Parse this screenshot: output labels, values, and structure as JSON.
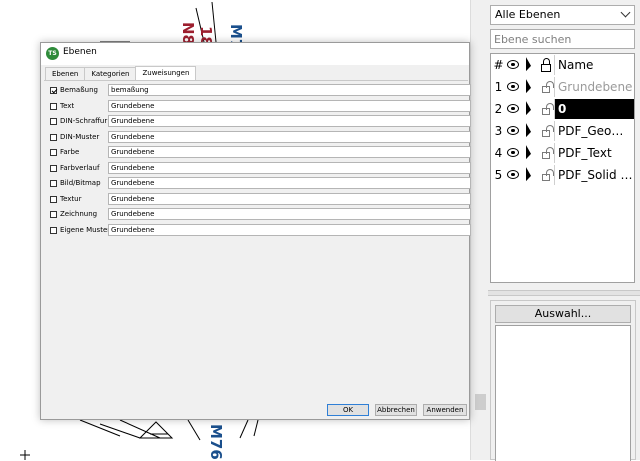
{
  "cad": {
    "labels": [
      "N8",
      "18",
      "M7",
      "M76"
    ]
  },
  "layer_panel": {
    "filter_value": "Alle Ebenen",
    "search_placeholder": "Ebene suchen",
    "columns": {
      "num": "#",
      "name": "Name"
    },
    "rows": [
      {
        "num": "1",
        "name": "Grundebene",
        "style": "gray",
        "locked": false
      },
      {
        "num": "2",
        "name": "0",
        "style": "selected",
        "locked": false
      },
      {
        "num": "3",
        "name": "PDF_Geome...",
        "style": "normal",
        "locked": false
      },
      {
        "num": "4",
        "name": "PDF_Text",
        "style": "normal",
        "locked": false
      },
      {
        "num": "5",
        "name": "PDF_Solid Fills",
        "style": "normal",
        "locked": false
      }
    ],
    "auswahl_label": "Auswahl..."
  },
  "dialog": {
    "app_icon_text": "TS",
    "title": "Ebenen",
    "tabs": [
      {
        "label": "Ebenen",
        "active": false
      },
      {
        "label": "Kategorien",
        "active": false
      },
      {
        "label": "Zuweisungen",
        "active": true
      }
    ],
    "assignments": [
      {
        "label": "Bemaßung",
        "value": "bemaßung",
        "checked": true
      },
      {
        "label": "Text",
        "value": "Grundebene",
        "checked": false
      },
      {
        "label": "DIN-Schraffur",
        "value": "Grundebene",
        "checked": false
      },
      {
        "label": "DIN-Muster",
        "value": "Grundebene",
        "checked": false
      },
      {
        "label": "Farbe",
        "value": "Grundebene",
        "checked": false
      },
      {
        "label": "Farbverlauf",
        "value": "Grundebene",
        "checked": false
      },
      {
        "label": "Bild/Bitmap",
        "value": "Grundebene",
        "checked": false
      },
      {
        "label": "Textur",
        "value": "Grundebene",
        "checked": false
      },
      {
        "label": "Zeichnung",
        "value": "Grundebene",
        "checked": false
      },
      {
        "label": "Eigene Muster",
        "value": "Grundebene",
        "checked": false
      }
    ],
    "ok_label": "OK",
    "cancel_label": "Abbrechen",
    "apply_label": "Anwenden"
  },
  "colors": {
    "label_red": "#9c1e2e",
    "label_blue": "#1a4f8c",
    "app_icon": "#2e8b3a",
    "ok_border": "#2f7fd6"
  }
}
